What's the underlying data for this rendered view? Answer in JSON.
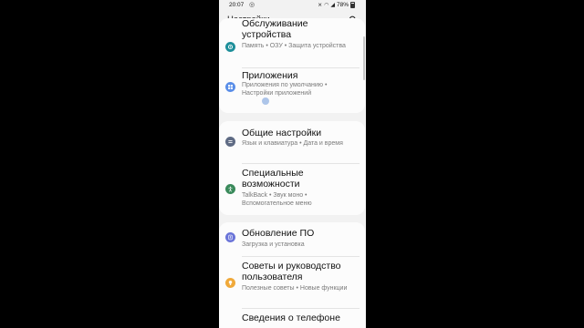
{
  "statusbar": {
    "time": "20:07",
    "battery": "78%"
  },
  "header": {
    "title": "Настройки"
  },
  "groups": [
    {
      "items": [
        {
          "title": "Обслуживание устройства",
          "subtitle": "Память  •  ОЗУ  •  Защита устройства",
          "icon": "device-care-icon",
          "color": "#1e8f9a"
        },
        {
          "title": "Приложения",
          "subtitle": "Приложения по умолчанию  •  Настройки приложений",
          "icon": "apps-icon",
          "color": "#5a8ee8"
        }
      ]
    },
    {
      "items": [
        {
          "title": "Общие настройки",
          "subtitle": "Язык и клавиатура  •  Дата и время",
          "icon": "general-management-icon",
          "color": "#5f6b84"
        },
        {
          "title": "Специальные возможности",
          "subtitle": "TalkBack  •  Звук моно  •  Вспомогательное меню",
          "icon": "accessibility-icon",
          "color": "#3a8a5b"
        }
      ]
    },
    {
      "items": [
        {
          "title": "Обновление ПО",
          "subtitle": "Загрузка и установка",
          "icon": "software-update-icon",
          "color": "#6a74d8"
        },
        {
          "title": "Советы и руководство пользователя",
          "subtitle": "Полезные советы  •  Новые функции",
          "icon": "tips-icon",
          "color": "#f0a93a"
        },
        {
          "title": "Сведения о телефоне",
          "subtitle": "",
          "icon": "about-phone-icon",
          "color": "#8a8a8a"
        }
      ]
    }
  ]
}
